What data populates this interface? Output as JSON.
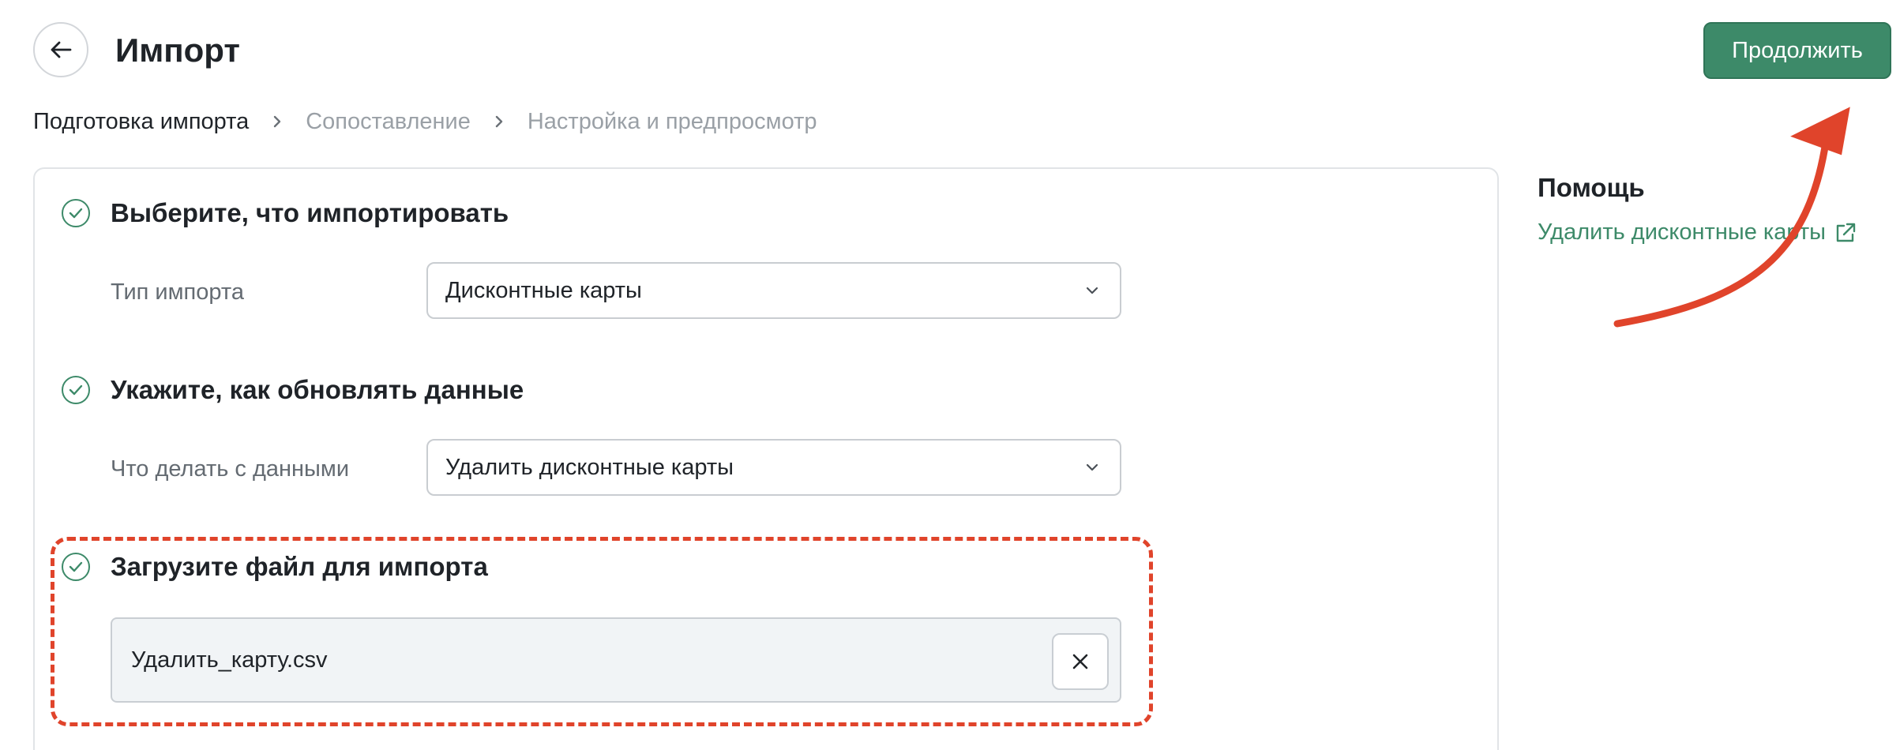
{
  "header": {
    "title": "Импорт",
    "continue_label": "Продолжить"
  },
  "breadcrumb": [
    {
      "label": "Подготовка импорта",
      "state": "active"
    },
    {
      "label": "Сопоставление",
      "state": "inactive"
    },
    {
      "label": "Настройка и предпросмотр",
      "state": "inactive"
    }
  ],
  "sections": {
    "import_type": {
      "title": "Выберите, что импортировать",
      "label": "Тип импорта",
      "value": "Дисконтные карты"
    },
    "update_mode": {
      "title": "Укажите, как обновлять данные",
      "label": "Что делать с данными",
      "value": "Удалить дисконтные карты"
    },
    "upload": {
      "title": "Загрузите файл для импорта",
      "file_name": "Удалить_карту.csv"
    }
  },
  "help": {
    "title": "Помощь",
    "link_label": "Удалить дисконтные карты"
  },
  "colors": {
    "accent": "#3d8a69",
    "annotation": "#e0442b",
    "muted_text": "#9aa0a6"
  },
  "icons": [
    "arrow-left-icon",
    "chevron-right-icon",
    "check-circle-icon",
    "chevron-down-icon",
    "close-icon",
    "external-link-icon"
  ]
}
